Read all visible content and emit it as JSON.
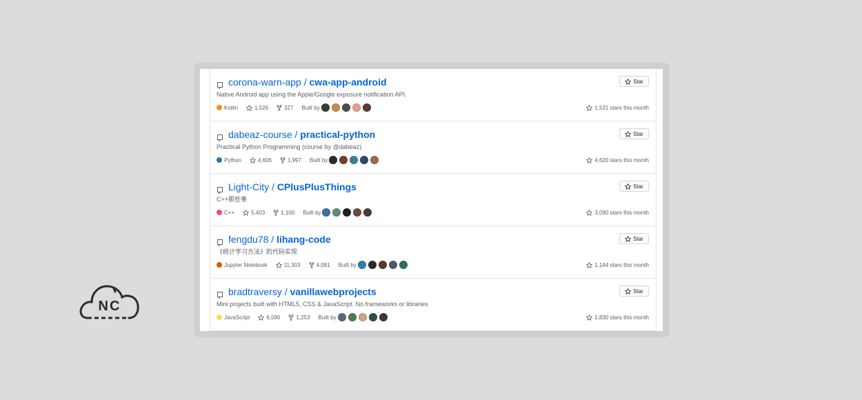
{
  "brand": {
    "logo_text": "NC"
  },
  "repos": [
    {
      "owner": "corona-warn-app",
      "separator": " / ",
      "name": "cwa-app-android",
      "description": "Native Android app using the Apple/Google exposure notification API.",
      "language": "Kotlin",
      "language_color": "#F18E33",
      "stars": "1,526",
      "forks": "327",
      "built_by_label": "Built by",
      "avatars": [
        "#3b3b3b",
        "#c98b4b",
        "#4d4d4d",
        "#e8a08c",
        "#5a3b2e"
      ],
      "star_label": "Star",
      "stars_today": "1,531 stars this month"
    },
    {
      "owner": "dabeaz-course",
      "separator": " / ",
      "name": "practical-python",
      "description": "Practical Python Programming (course by @dabeaz)",
      "language": "Python",
      "language_color": "#3572A5",
      "stars": "4,606",
      "forks": "1,997",
      "built_by_label": "Built by",
      "avatars": [
        "#2b2b2b",
        "#7a3b2b",
        "#3a7fa0",
        "#2c4a6b",
        "#9a6a4a"
      ],
      "star_label": "Star",
      "stars_today": "4,620 stars this month"
    },
    {
      "owner": "Light-City",
      "separator": " / ",
      "name": "CPlusPlusThings",
      "description": "C++那些事",
      "language": "C++",
      "language_color": "#f34b7d",
      "stars": "5,403",
      "forks": "1,100",
      "built_by_label": "Built by",
      "avatars": [
        "#3f6f9f",
        "#5f8f6f",
        "#1f1f1f",
        "#6b4a3a",
        "#4a3a3a"
      ],
      "star_label": "Star",
      "stars_today": "3,090 stars this month"
    },
    {
      "owner": "fengdu78",
      "separator": " / ",
      "name": "lihang-code",
      "description": "《统计学习方法》的代码实现",
      "language": "Jupyter Notebook",
      "language_color": "#DA5B0B",
      "stars": "11,303",
      "forks": "4,081",
      "built_by_label": "Built by",
      "avatars": [
        "#2f7fb0",
        "#2b2b2b",
        "#5a3a2a",
        "#4a5a6a",
        "#2f6f5f"
      ],
      "star_label": "Star",
      "stars_today": "1,144 stars this month"
    },
    {
      "owner": "bradtraversy",
      "separator": " / ",
      "name": "vanillawebprojects",
      "description": "Mini projects built with HTML5, CSS & JavaScript. No frameworks or libraries",
      "language": "JavaScript",
      "language_color": "#f1e05a",
      "stars": "6,590",
      "forks": "1,253",
      "built_by_label": "Built by",
      "avatars": [
        "#5a6a7a",
        "#4a7a5a",
        "#c9a88b",
        "#2f4f3f",
        "#3a3a3a"
      ],
      "star_label": "Star",
      "stars_today": "1,830 stars this month"
    }
  ]
}
